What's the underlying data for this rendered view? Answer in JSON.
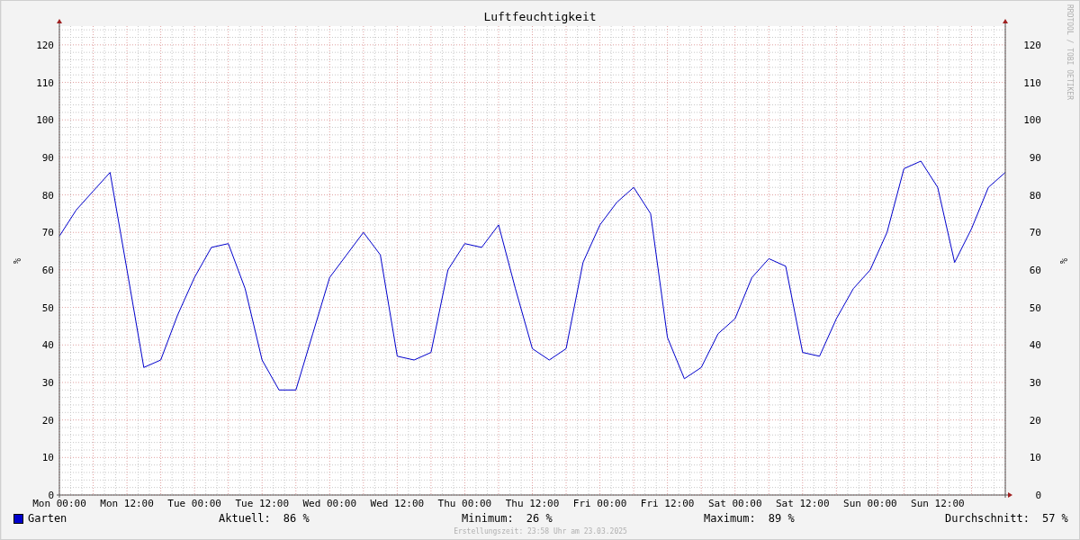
{
  "graph": {
    "title": "Luftfeuchtigkeit",
    "credit": "RRDTOOL / TOBI OETIKER",
    "chart_data": {
      "type": "line",
      "grid": true,
      "ylabel": "%",
      "ylim": [
        0,
        125
      ],
      "categories": [
        "Mon 00:00",
        null,
        null,
        null,
        "Mon 12:00",
        null,
        null,
        null,
        "Tue 00:00",
        null,
        null,
        null,
        "Tue 12:00",
        null,
        null,
        null,
        "Wed 00:00",
        null,
        null,
        null,
        "Wed 12:00",
        null,
        null,
        null,
        "Thu 00:00",
        null,
        null,
        null,
        "Thu 12:00",
        null,
        null,
        null,
        "Fri 00:00",
        null,
        null,
        null,
        "Fri 12:00",
        null,
        null,
        null,
        "Sat 00:00",
        null,
        null,
        null,
        "Sat 12:00",
        null,
        null,
        null,
        "Sun 00:00",
        null,
        null,
        null,
        "Sun 12:00",
        null,
        null,
        null,
        null
      ],
      "yticks": [
        0,
        10,
        20,
        30,
        40,
        50,
        60,
        70,
        80,
        90,
        100,
        110,
        120
      ],
      "series": [
        {
          "name": "Garten",
          "color": "#0000cc",
          "values": [
            69,
            76,
            81,
            86,
            60,
            34,
            36,
            48,
            58,
            66,
            67,
            55,
            36,
            28,
            28,
            43,
            58,
            64,
            70,
            64,
            37,
            36,
            38,
            60,
            67,
            66,
            72,
            55,
            39,
            36,
            39,
            62,
            72,
            78,
            82,
            75,
            42,
            31,
            34,
            43,
            47,
            58,
            63,
            61,
            38,
            37,
            47,
            55,
            60,
            70,
            87,
            89,
            82,
            62,
            71,
            82,
            86
          ]
        }
      ]
    },
    "right_axis": {
      "label": "%",
      "ticks": [
        "120",
        "110",
        "100",
        "90",
        "80",
        "70",
        "60",
        "50",
        "40",
        "30",
        "20",
        "10",
        "0"
      ]
    }
  },
  "legend": {
    "stats": [
      {
        "label": "Aktuell:",
        "value": "86 %"
      },
      {
        "label": "Minimum:",
        "value": "26 %"
      },
      {
        "label": "Maximum:",
        "value": "89 %"
      },
      {
        "label": "Durchschnitt:",
        "value": "57 %"
      }
    ]
  },
  "footer": "Erstellungszeit: 23:58 Uhr am 23.03.2025"
}
